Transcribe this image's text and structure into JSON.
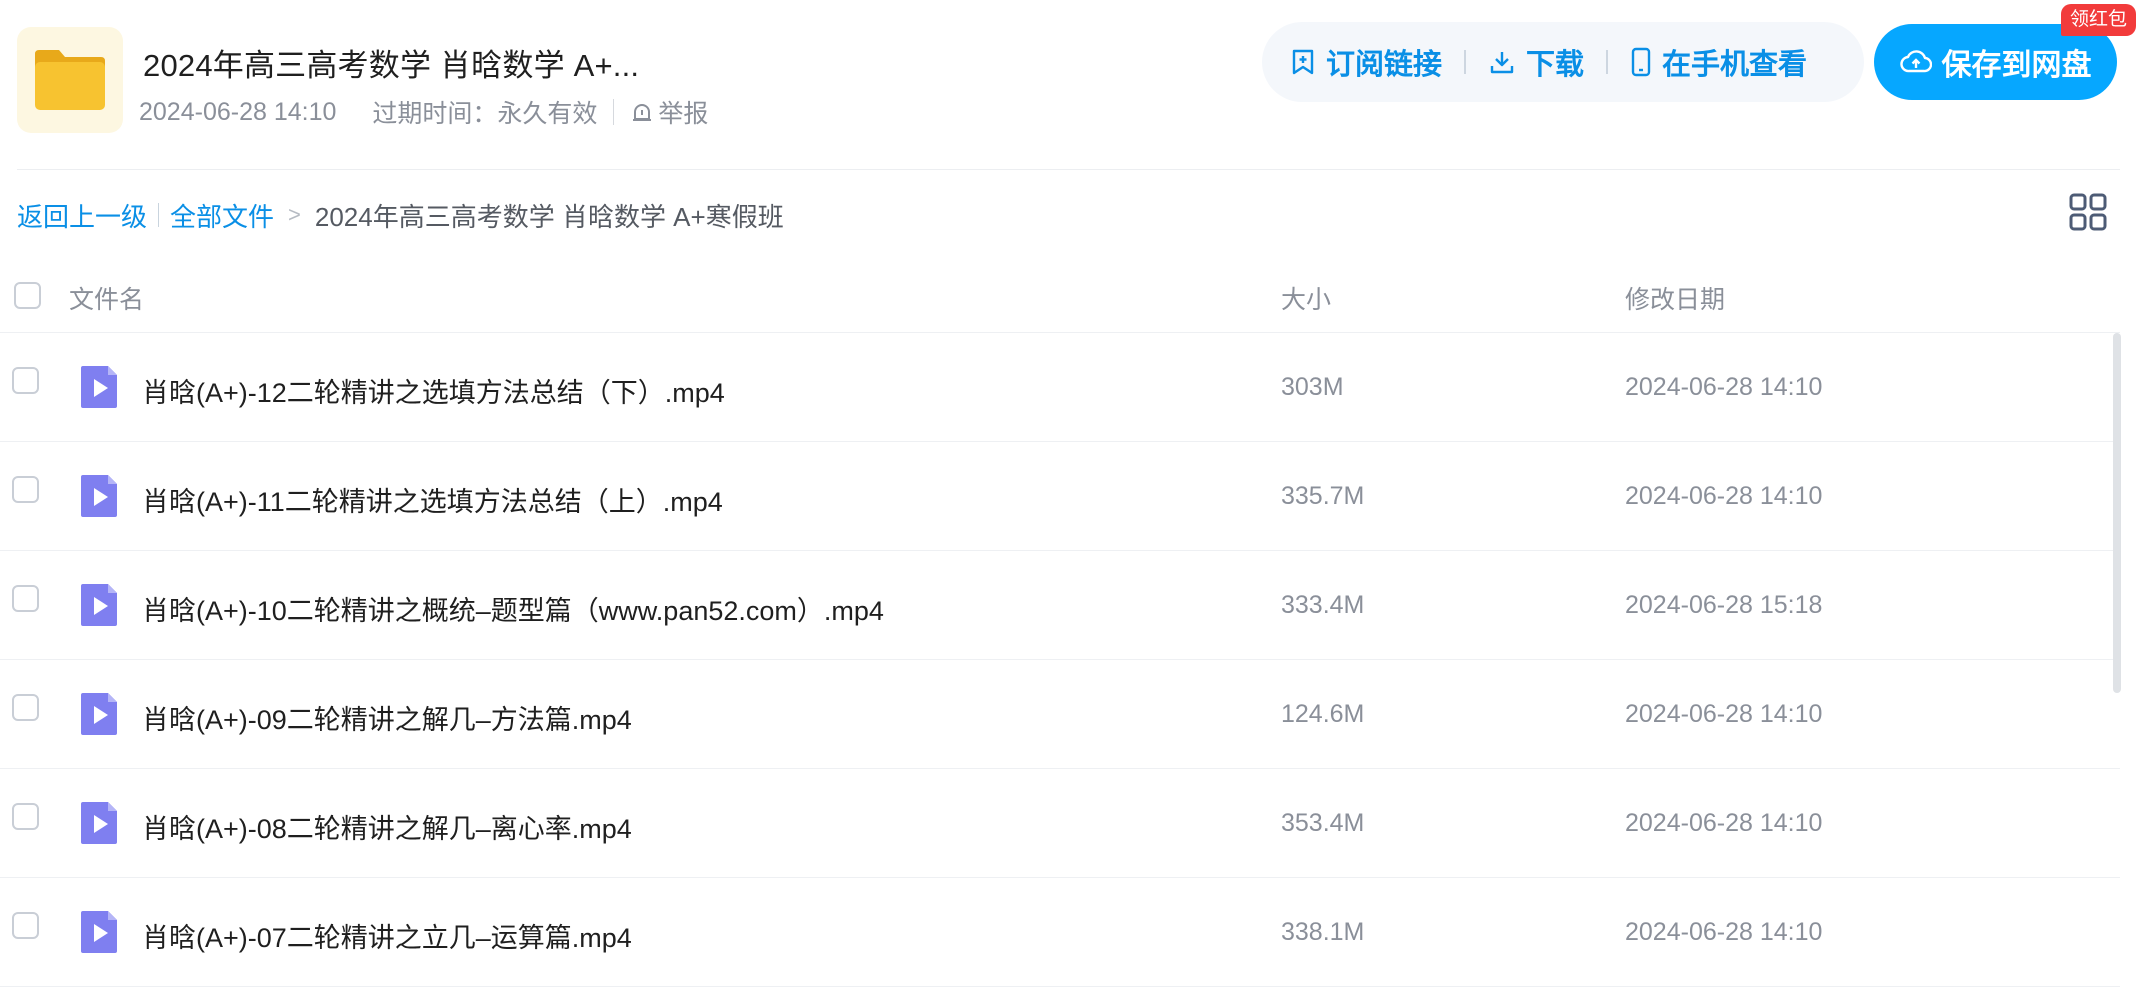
{
  "header": {
    "title": "2024年高三高考数学 肖晗数学 A+...",
    "date": "2024-06-28 14:10",
    "expiry": "过期时间：永久有效",
    "report": "举报",
    "actions": {
      "subscribe": "订阅链接",
      "download": "下载",
      "mobile": "在手机查看"
    },
    "save_button": "保存到网盘",
    "badge": "领红包"
  },
  "breadcrumb": {
    "back": "返回上一级",
    "all_files": "全部文件",
    "current": "2024年高三高考数学 肖晗数学 A+寒假班"
  },
  "table": {
    "columns": {
      "name": "文件名",
      "size": "大小",
      "date": "修改日期"
    },
    "rows": [
      {
        "name": "肖晗(A+)-12二轮精讲之选填方法总结（下）.mp4",
        "size": "303M",
        "date": "2024-06-28 14:10"
      },
      {
        "name": "肖晗(A+)-11二轮精讲之选填方法总结（上）.mp4",
        "size": "335.7M",
        "date": "2024-06-28 14:10"
      },
      {
        "name": "肖晗(A+)-10二轮精讲之概统–题型篇（www.pan52.com）.mp4",
        "size": "333.4M",
        "date": "2024-06-28 15:18"
      },
      {
        "name": "肖晗(A+)-09二轮精讲之解几–方法篇.mp4",
        "size": "124.6M",
        "date": "2024-06-28 14:10"
      },
      {
        "name": "肖晗(A+)-08二轮精讲之解几–离心率.mp4",
        "size": "353.4M",
        "date": "2024-06-28 14:10"
      },
      {
        "name": "肖晗(A+)-07二轮精讲之立几–运算篇.mp4",
        "size": "338.1M",
        "date": "2024-06-28 14:10"
      }
    ]
  },
  "colors": {
    "accent": "#0a8fe6",
    "save_button": "#06a7ff",
    "badge": "#f23b3b",
    "folder": "#f7c330",
    "video_icon": "#7f7ff0"
  },
  "icons": {
    "folder": "folder-icon",
    "subscribe": "bookmark-plus-icon",
    "download": "download-icon",
    "mobile": "phone-icon",
    "save": "cloud-upload-icon",
    "report": "alarm-icon",
    "grid": "grid-view-icon",
    "file": "video-file-icon"
  }
}
